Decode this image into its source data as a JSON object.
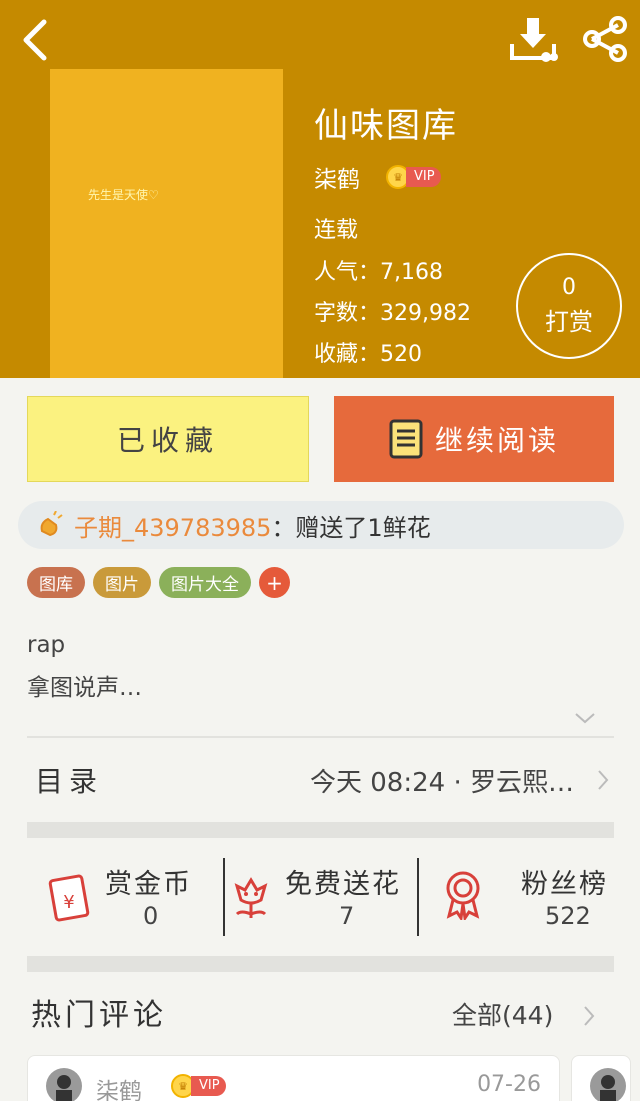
{
  "book": {
    "cover_text": "先生是天使♡",
    "title": "仙味图库",
    "author": "柒鹤",
    "vip_label": "VIP",
    "status": "连载",
    "popularity_label": "人气：",
    "popularity": "7,168",
    "words_label": "字数：",
    "words": "329,982",
    "favorites_label": "收藏：",
    "favorites": "520",
    "reward_count": "0",
    "reward_label": "打赏"
  },
  "header": {
    "back_icon": "chevron-left-icon",
    "download_icon": "download-icon",
    "share_icon": "share-icon",
    "bg_color": "#c58a00"
  },
  "actions": {
    "favorited_label": "已收藏",
    "continue_label": "继续阅读"
  },
  "gift_banner": {
    "user": "子期_439783985",
    "text": "：赠送了1鲜花"
  },
  "tags": [
    {
      "label": "图库",
      "color": "#c8724f"
    },
    {
      "label": "图片",
      "color": "#c99a3a"
    },
    {
      "label": "图片大全",
      "color": "#8bb05a"
    },
    {
      "label": "+",
      "color": "#e55a3a"
    }
  ],
  "description": {
    "line1": "rap",
    "line2": "拿图说声…"
  },
  "toc": {
    "label": "目录",
    "latest": "今天 08:24 · 罗云熙…"
  },
  "stats": [
    {
      "label": "赏金币",
      "value": "0"
    },
    {
      "label": "免费送花",
      "value": "7"
    },
    {
      "label": "粉丝榜",
      "value": "522"
    }
  ],
  "comments": {
    "title": "热门评论",
    "all_label": "全部(44)",
    "items": [
      {
        "author": "柒鹤",
        "vip": "VIP",
        "date": "07-26"
      }
    ]
  }
}
